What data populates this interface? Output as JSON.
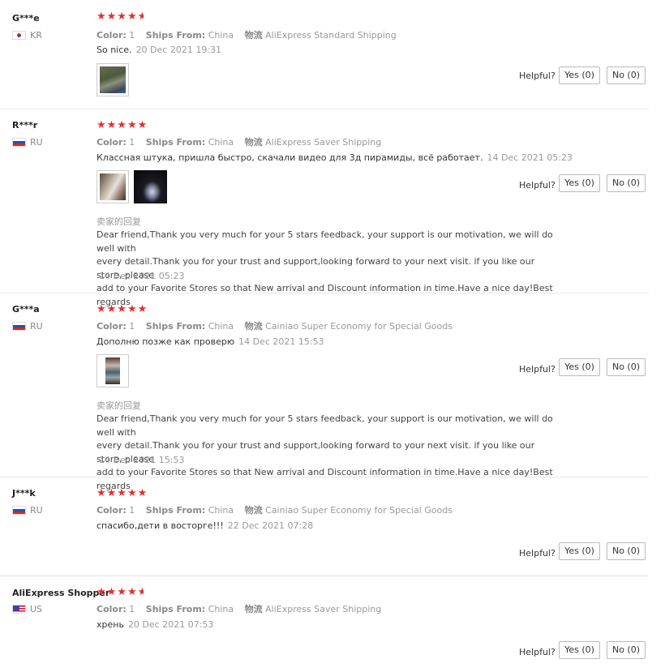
{
  "labels": {
    "color": "Color:",
    "ships_from": "Ships From:",
    "logistics": "物流",
    "helpful": "Helpful?",
    "reply_title": "卖家的回复"
  },
  "reviews": [
    {
      "name": "G***e",
      "country": "KR",
      "stars": 4.5,
      "color": "1",
      "ships_from": "China",
      "shipping": "AliExpress Standard Shipping",
      "text": "So nice.",
      "date": "20 Dec 2021 19:31",
      "yes": "Yes (0)",
      "no": "No (0)"
    },
    {
      "name": "R***r",
      "country": "RU",
      "stars": 5,
      "color": "1",
      "ships_from": "China",
      "shipping": "AliExpress Saver Shipping",
      "text": "Классная штука, пришла быстро, скачали видео для 3д пирамиды, всё работает.",
      "date": "14 Dec 2021 05:23",
      "yes": "Yes (0)",
      "no": "No (0)",
      "reply": "Dear friend,Thank you very much for your 5 stars feedback, your support is our motivation, we will do well with\nevery detail.Thank you for your trust and support,looking forward to your next visit. if you like our store, please\nadd to your Favorite Stores so that New arrival and Discount information in time.Have a nice day!Best regards",
      "reply_date": "14 Dec 2021 05:23"
    },
    {
      "name": "G***a",
      "country": "RU",
      "stars": 5,
      "color": "1",
      "ships_from": "China",
      "shipping": "Cainiao Super Economy for Special Goods",
      "text": "Дополню позже как проверю",
      "date": "14 Dec 2021 15:53",
      "yes": "Yes (0)",
      "no": "No (0)",
      "reply": "Dear friend,Thank you very much for your 5 stars feedback, your support is our motivation, we will do well with\nevery detail.Thank you for your trust and support,looking forward to your next visit. if you like our store, please\nadd to your Favorite Stores so that New arrival and Discount information in time.Have a nice day!Best regards",
      "reply_date": "14 Dec 2021 15:53"
    },
    {
      "name": "J***k",
      "country": "RU",
      "stars": 5,
      "color": "1",
      "ships_from": "China",
      "shipping": "Cainiao Super Economy for Special Goods",
      "text": "спасибо,дети в восторге!!!",
      "date": "22 Dec 2021 07:28",
      "yes": "Yes (0)",
      "no": "No (0)"
    },
    {
      "name": "AliExpress Shopper",
      "country": "US",
      "stars": 4.5,
      "color": "1",
      "ships_from": "China",
      "shipping": "AliExpress Saver Shipping",
      "text": "хрень",
      "date": "20 Dec 2021 07:53",
      "yes": "Yes (0)",
      "no": "No (0)"
    }
  ]
}
